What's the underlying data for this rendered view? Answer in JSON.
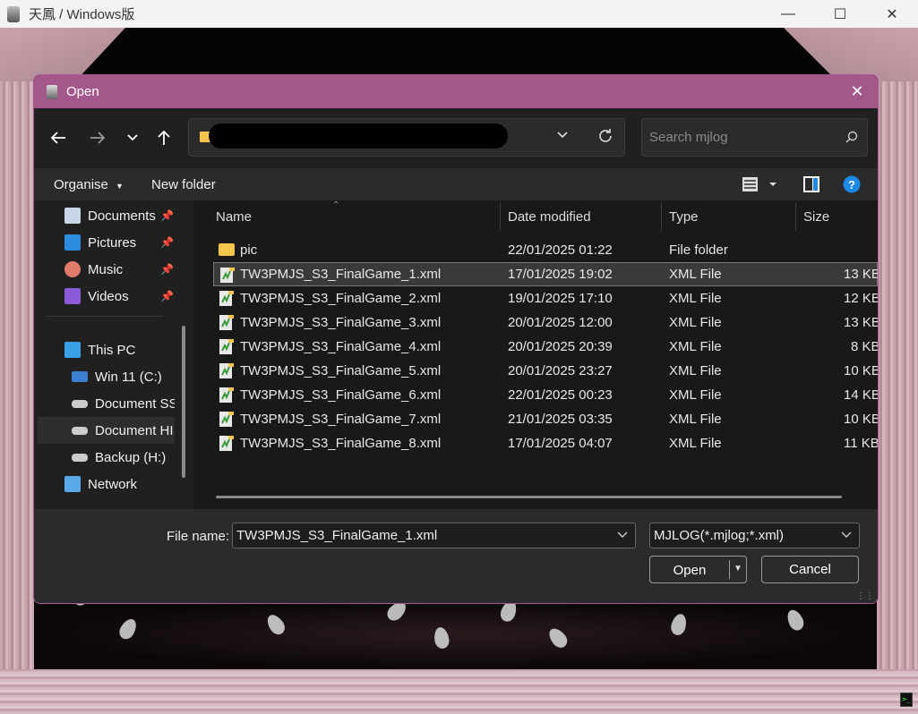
{
  "app": {
    "title": "天鳳 / Windows版"
  },
  "dialog": {
    "title": "Open",
    "search_placeholder": "Search mjlog",
    "toolbar": {
      "organise": "Organise",
      "new_folder": "New folder"
    },
    "sidebar": [
      {
        "label": "Documents",
        "icon": "documents-icon",
        "pinned": true
      },
      {
        "label": "Pictures",
        "icon": "pictures-icon",
        "pinned": true
      },
      {
        "label": "Music",
        "icon": "music-icon",
        "pinned": true
      },
      {
        "label": "Videos",
        "icon": "videos-icon",
        "pinned": true
      },
      {
        "label": "This PC",
        "icon": "pc-icon"
      },
      {
        "label": "Win 11 (C:)",
        "icon": "drive-windows-icon"
      },
      {
        "label": "Document SS",
        "icon": "drive-icon"
      },
      {
        "label": "Document HI",
        "icon": "drive-icon",
        "selected": true
      },
      {
        "label": "Backup (H:)",
        "icon": "drive-icon"
      },
      {
        "label": "Network",
        "icon": "network-icon"
      }
    ],
    "columns": {
      "name": "Name",
      "date": "Date modified",
      "type": "Type",
      "size": "Size"
    },
    "files": [
      {
        "name": "pic",
        "date": "22/01/2025 01:22",
        "type": "File folder",
        "size": ""
      },
      {
        "name": "TW3PMJS_S3_FinalGame_1.xml",
        "date": "17/01/2025 19:02",
        "type": "XML File",
        "size": "13 KB"
      },
      {
        "name": "TW3PMJS_S3_FinalGame_2.xml",
        "date": "19/01/2025 17:10",
        "type": "XML File",
        "size": "12 KB"
      },
      {
        "name": "TW3PMJS_S3_FinalGame_3.xml",
        "date": "20/01/2025 12:00",
        "type": "XML File",
        "size": "13 KB"
      },
      {
        "name": "TW3PMJS_S3_FinalGame_4.xml",
        "date": "20/01/2025 20:39",
        "type": "XML File",
        "size": "8 KB"
      },
      {
        "name": "TW3PMJS_S3_FinalGame_5.xml",
        "date": "20/01/2025 23:27",
        "type": "XML File",
        "size": "10 KB"
      },
      {
        "name": "TW3PMJS_S3_FinalGame_6.xml",
        "date": "22/01/2025 00:23",
        "type": "XML File",
        "size": "14 KB"
      },
      {
        "name": "TW3PMJS_S3_FinalGame_7.xml",
        "date": "21/01/2025 03:35",
        "type": "XML File",
        "size": "10 KB"
      },
      {
        "name": "TW3PMJS_S3_FinalGame_8.xml",
        "date": "17/01/2025 04:07",
        "type": "XML File",
        "size": "11 KB"
      }
    ],
    "file_name_label": "File name:",
    "file_name_value": "TW3PMJS_S3_FinalGame_1.xml",
    "file_type_value": "MJLOG(*.mjlog;*.xml)",
    "open_label": "Open",
    "cancel_label": "Cancel"
  },
  "colors": {
    "title_bar": "#a3578b",
    "folder": "#f4c54a",
    "help": "#1e88e5"
  }
}
